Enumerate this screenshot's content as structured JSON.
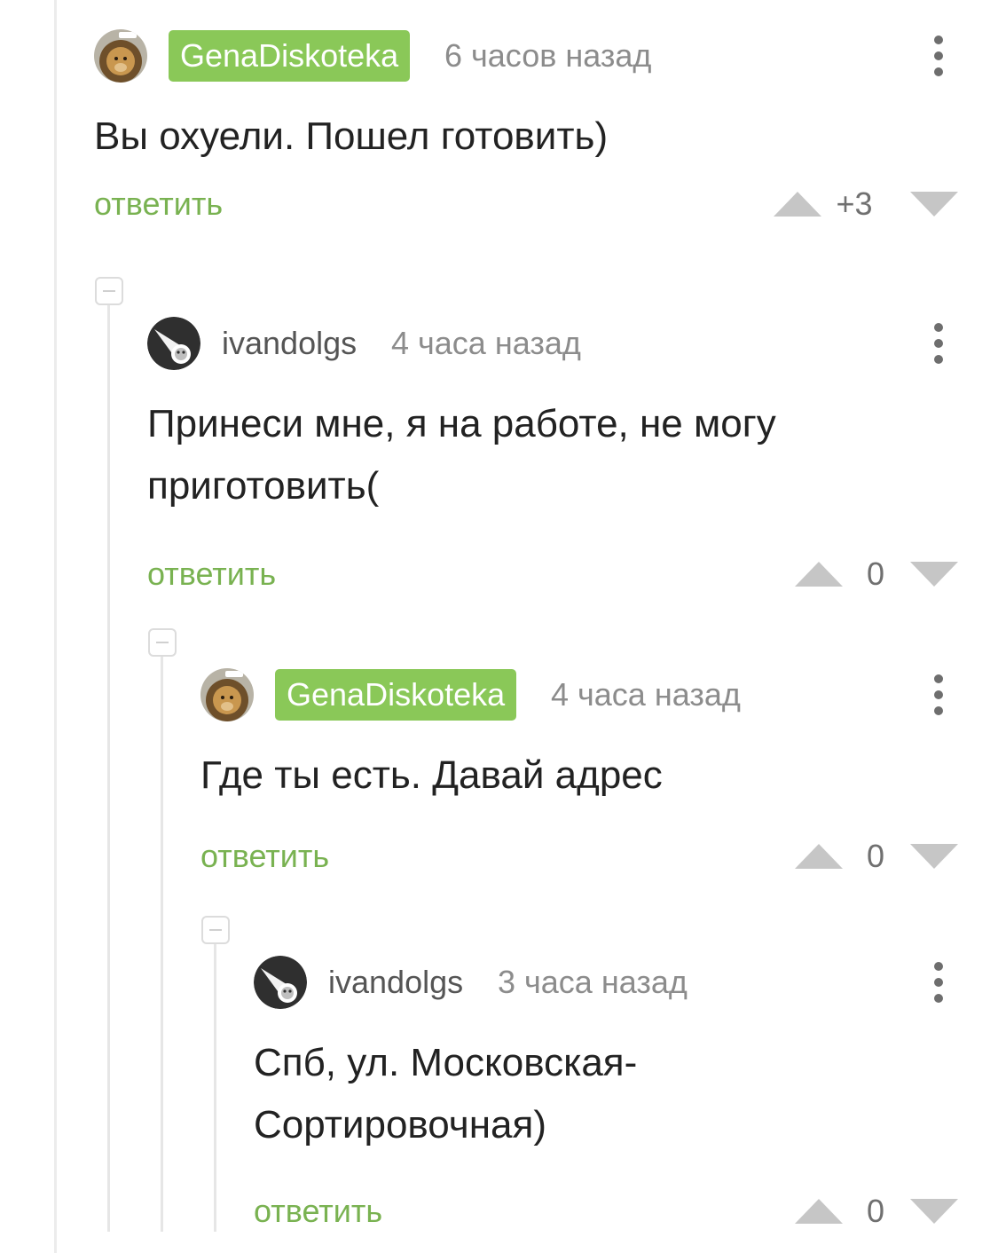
{
  "comments": [
    {
      "author": "GenaDiskoteka",
      "author_is_op": true,
      "time": "6 часов назад",
      "lines": [
        "Вы охуели. Пошел готовить)"
      ],
      "reply_label": "ответить",
      "score": "+3",
      "avatar_icon": "lion-avatar-icon"
    },
    {
      "author": "ivandolgs",
      "author_is_op": false,
      "time": "4 часа назад",
      "lines": [
        "Принеси мне, я на работе, не могу",
        "приготовить("
      ],
      "reply_label": "ответить",
      "score": "0",
      "avatar_icon": "comet-avatar-icon"
    },
    {
      "author": "GenaDiskoteka",
      "author_is_op": true,
      "time": "4 часа назад",
      "lines": [
        "Где ты есть. Давай адрес"
      ],
      "reply_label": "ответить",
      "score": "0",
      "avatar_icon": "lion-avatar-icon"
    },
    {
      "author": "ivandolgs",
      "author_is_op": false,
      "time": "3 часа назад",
      "lines": [
        "Спб, ул. Московская-",
        "Сортировочная)"
      ],
      "reply_label": "ответить",
      "score": "0",
      "avatar_icon": "comet-avatar-icon"
    }
  ],
  "colors": {
    "op_badge": "#8ac858",
    "reply_link": "#79b251",
    "vote_arrow": "#c6c6c6",
    "timestamp": "#8c8c8c"
  },
  "icons": [
    "lion-avatar-icon",
    "comet-avatar-icon",
    "more-vertical-icon",
    "vote-up-icon",
    "vote-down-icon",
    "collapse-icon"
  ]
}
